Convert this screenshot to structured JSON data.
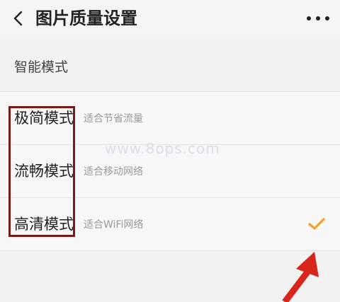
{
  "header": {
    "title": "图片质量设置",
    "back_icon": "chevron-left-icon",
    "more_icon": "more-horizontal-icon"
  },
  "section": {
    "label": "智能模式"
  },
  "options": [
    {
      "title": "极简模式",
      "subtitle": "适合节省流量",
      "selected": false
    },
    {
      "title": "流畅模式",
      "subtitle": "适合移动网络",
      "selected": false
    },
    {
      "title": "高清模式",
      "subtitle": "适合WiFi网络",
      "selected": true
    }
  ],
  "watermark": "www.8ops.com",
  "colors": {
    "check": "#f0a030",
    "highlight_box": "#7a1a18",
    "arrow": "#d9261c"
  }
}
